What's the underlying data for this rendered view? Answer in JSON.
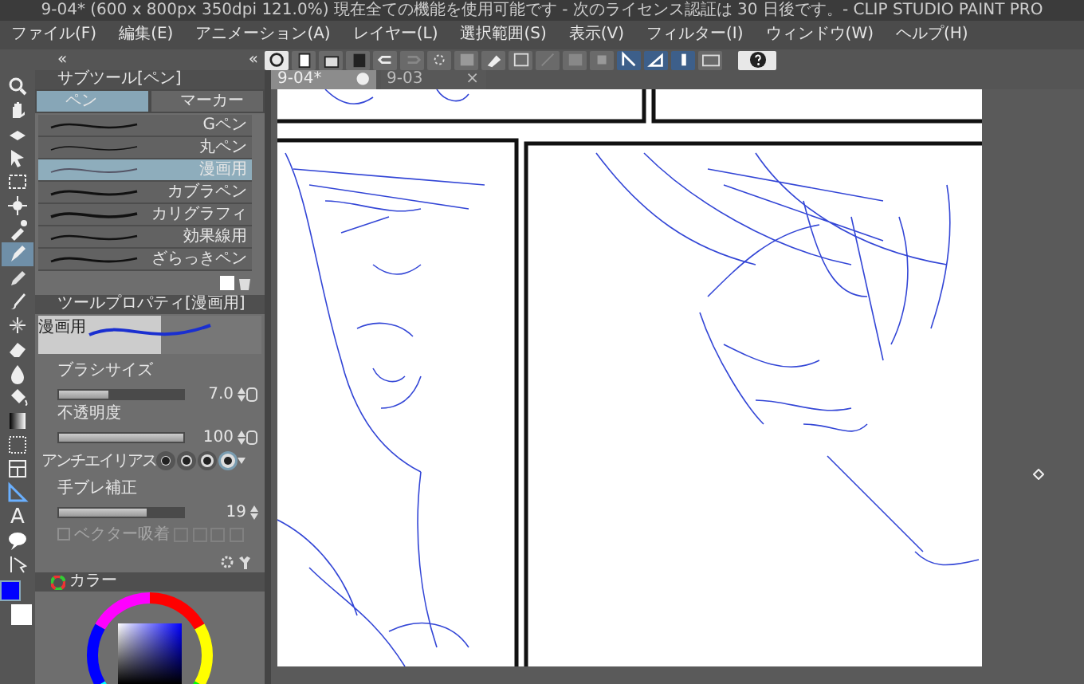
{
  "window": {
    "title": "9-04* (600 x 800px 350dpi 121.0%)  現在全ての機能を使用可能です - 次のライセンス認証は 30 日後です。- CLIP STUDIO PAINT PRO"
  },
  "menu": [
    "ファイル(F)",
    "編集(E)",
    "アニメーション(A)",
    "レイヤー(L)",
    "選択範囲(S)",
    "表示(V)",
    "フィルター(I)",
    "ウィンドウ(W)",
    "ヘルプ(H)"
  ],
  "dock_marks": [
    "«",
    "«"
  ],
  "snap_toggles": [
    {
      "on": true
    },
    {
      "on": true
    },
    {
      "on": true
    }
  ],
  "document_tabs": [
    {
      "label": "9-04*",
      "mark": "●",
      "selected": true
    },
    {
      "label": "9-03",
      "mark": "×",
      "selected": false
    }
  ],
  "tools": [
    {
      "kind": "zoom",
      "selected": false
    },
    {
      "kind": "hand",
      "selected": false
    },
    {
      "kind": "rotate",
      "selected": false
    },
    {
      "kind": "move",
      "selected": false
    },
    {
      "kind": "select",
      "selected": false
    },
    {
      "kind": "autoselect",
      "selected": false
    },
    {
      "kind": "eyedropper",
      "selected": false
    },
    {
      "kind": "pen",
      "selected": true
    },
    {
      "kind": "pencil",
      "selected": false
    },
    {
      "kind": "brush",
      "selected": false
    },
    {
      "kind": "decoration",
      "selected": false
    },
    {
      "kind": "eraser",
      "selected": false
    },
    {
      "kind": "blend",
      "selected": false
    },
    {
      "kind": "fill",
      "selected": false
    },
    {
      "kind": "gradient",
      "selected": false
    },
    {
      "kind": "figure",
      "selected": false
    },
    {
      "kind": "frame",
      "selected": false
    },
    {
      "kind": "ruler",
      "selected": false
    },
    {
      "kind": "text",
      "glyph": "A",
      "selected": false
    },
    {
      "kind": "balloon",
      "selected": false
    },
    {
      "kind": "correct",
      "selected": false
    }
  ],
  "colors": {
    "main": {
      "color": "#0000ff"
    },
    "sub": {
      "color": "#ffffff"
    }
  },
  "sub_tool_panel": {
    "title": "サブツール[ペン]",
    "groups": [
      {
        "label": "ペン",
        "selected": true
      },
      {
        "label": "マーカー",
        "selected": false
      }
    ],
    "items": [
      {
        "label": "Gペン",
        "selected": false
      },
      {
        "label": "丸ペン",
        "selected": false
      },
      {
        "label": "漫画用",
        "selected": true
      },
      {
        "label": "カブラペン",
        "selected": false
      },
      {
        "label": "カリグラフィ",
        "selected": false
      },
      {
        "label": "効果線用",
        "selected": false
      },
      {
        "label": "ざらっきペン",
        "selected": false
      }
    ]
  },
  "tool_property": {
    "title": "ツールプロパティ[漫画用]",
    "preview_label": "漫画用",
    "brush_size": {
      "label": "ブラシサイズ",
      "value": "7.0",
      "level": 0.4
    },
    "opacity": {
      "label": "不透明度",
      "value": "100",
      "level": 1
    },
    "antialiasing": {
      "label": "アンチエイリアス",
      "options": [
        {
          "selected": false
        },
        {
          "selected": false
        },
        {
          "selected": false
        },
        {
          "selected": true
        }
      ]
    },
    "stabilization": {
      "label": "手ブレ補正",
      "value": "19",
      "level": 0.7
    },
    "vector_snap": {
      "label": "ベクター吸着",
      "checked": false,
      "disabled": true
    }
  },
  "color_panel": {
    "title": "カラー"
  }
}
